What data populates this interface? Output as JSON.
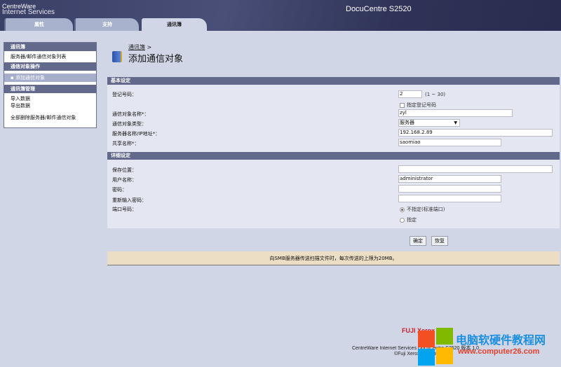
{
  "header": {
    "brand_line1": "CentreWare",
    "brand_line2": "Internet Services",
    "model": "DocuCentre S2520"
  },
  "tabs": [
    {
      "label": "属性"
    },
    {
      "label": "支持"
    },
    {
      "label": "通讯簿"
    }
  ],
  "sidebar": {
    "sections": [
      {
        "title": "通讯簿",
        "items": [
          "服务器/邮件通信对象列表"
        ]
      },
      {
        "title": "通信对象操作",
        "items": [
          "添加通信对象"
        ]
      },
      {
        "title": "通讯簿管理",
        "items": [
          "导入数据",
          "导出数据",
          "全部删除服务器/邮件通信对象"
        ]
      }
    ]
  },
  "breadcrumb": {
    "link": "通讯簿",
    "sep": ">"
  },
  "page_title": "添加通信对象",
  "basic": {
    "title": "基本设定",
    "reg_label": "登记号码：",
    "reg_value": "2",
    "reg_range": "(1 ~ 30)",
    "reg_checkbox": "指定登记号码",
    "name_label": "通信对象名称*：",
    "name_value": "zyl",
    "type_label": "通信对象类型：",
    "type_value": "服务器",
    "server_label": "服务器名称/IP地址*：",
    "server_value": "192.168.2.89",
    "share_label": "共享名称*：",
    "share_value": "saomiao"
  },
  "detail": {
    "title": "详细设定",
    "save_label": "保存位置：",
    "save_value": "",
    "user_label": "用户名称：",
    "user_value": "administrator",
    "pw_label": "密码：",
    "pw2_label": "重新输入密码：",
    "port_label": "端口号码：",
    "port_opt1": "不指定(标准端口)",
    "port_opt2": "指定"
  },
  "buttons": {
    "ok": "确定",
    "restore": "恢复"
  },
  "message": "向SMB服务器传送扫描文件时，每次传送的上限为20MB。",
  "footer": {
    "logo": "FUJI Xerox",
    "line1": "CentreWare Internet Services DocuCentre S2520 版本 1.0",
    "line2": "©Fuji Xerox Co., Ltd. 2014"
  },
  "watermark": {
    "title": "电脑软硬件教程网",
    "url": "www.computer26.com"
  },
  "colors": {
    "section": "#62698a",
    "background": "#d1d6e7",
    "message": "#ebdec4"
  }
}
